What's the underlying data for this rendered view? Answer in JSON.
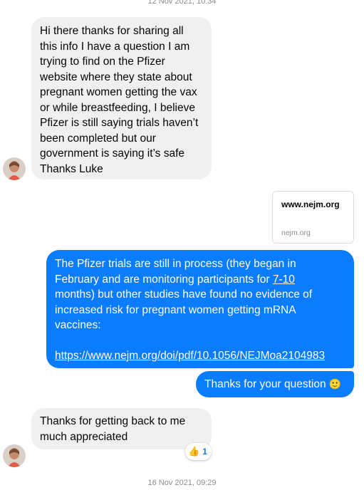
{
  "timestamps": {
    "top": "12 Nov 2021, 10:34",
    "bottom": "16 Nov 2021, 09:29"
  },
  "messages": {
    "incoming_1": {
      "lines": [
        "Hi there thanks for sharing all",
        "this info I have a question I am",
        "trying to find on the Pfizer",
        "website where they state about",
        "pregnant women getting the vax",
        "or while breastfeeding, I believe",
        "Pfizer is still saying trials haven’t",
        "been completed but our",
        "government is saying it’s safe",
        "Thanks Luke"
      ]
    },
    "link_preview": {
      "title": "www.nejm.org",
      "domain": "nejm.org"
    },
    "outgoing_1": {
      "line1": "The Pfizer trials are still in process (they began in",
      "line2_pre": "February and are monitoring participants for ",
      "line2_link": "7-10",
      "line3": "months) but other studies have found no evidence of",
      "line4": "increased risk for pregnant women getting mRNA",
      "line5": "vaccines:",
      "url": "https://www.nejm.org/doi/pdf/10.1056/NEJMoa2104983"
    },
    "outgoing_2": {
      "text": "Thanks for your question",
      "emoji": "🙂"
    },
    "incoming_2": {
      "lines": [
        "Thanks for getting back to me",
        "much appreciated"
      ],
      "reaction_emoji": "👍",
      "reaction_count": "1"
    }
  },
  "colors": {
    "outgoing_bubble": "#0a7cff",
    "incoming_bubble": "#f0f0f0"
  }
}
